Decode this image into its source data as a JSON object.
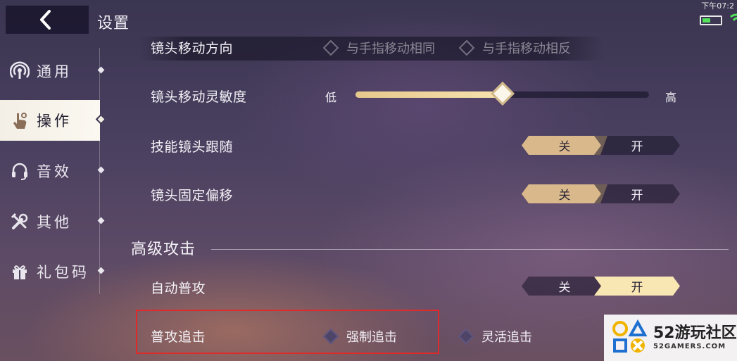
{
  "header": {
    "title": "设置",
    "time": "下午07:2"
  },
  "sidebar": {
    "items": [
      {
        "label": "通用",
        "icon": "signal-icon",
        "active": false
      },
      {
        "label": "操作",
        "icon": "hand-pointer-icon",
        "active": true
      },
      {
        "label": "音效",
        "icon": "headset-icon",
        "active": false
      },
      {
        "label": "其他",
        "icon": "tools-icon",
        "active": false
      },
      {
        "label": "礼包码",
        "icon": "gift-icon",
        "active": false
      }
    ]
  },
  "settings": {
    "camera_direction": {
      "label": "镜头移动方向",
      "options": [
        "与手指移动相同",
        "与手指移动相反"
      ]
    },
    "camera_sensitivity": {
      "label": "镜头移动灵敏度",
      "low": "低",
      "high": "高",
      "value": 0.5
    },
    "skill_camera_follow": {
      "label": "技能镜头跟随",
      "off": "关",
      "on": "开",
      "state": "off"
    },
    "camera_fixed_offset": {
      "label": "镜头固定偏移",
      "off": "关",
      "on": "开",
      "state": "off"
    }
  },
  "advanced": {
    "section_title": "高级攻击",
    "auto_attack": {
      "label": "自动普攻",
      "off": "关",
      "on": "开",
      "state": "on"
    },
    "attack_chase": {
      "label": "普攻追击",
      "options": [
        "强制追击",
        "灵活追击"
      ]
    }
  },
  "watermark": {
    "name": "52游玩社区",
    "site": "52GAMERS.COM"
  },
  "colors": {
    "accent_gold": "#d9b98c",
    "accent_light": "#f8e7b2",
    "highlight_red": "#e02a2a",
    "battery_green": "#53e35a"
  }
}
